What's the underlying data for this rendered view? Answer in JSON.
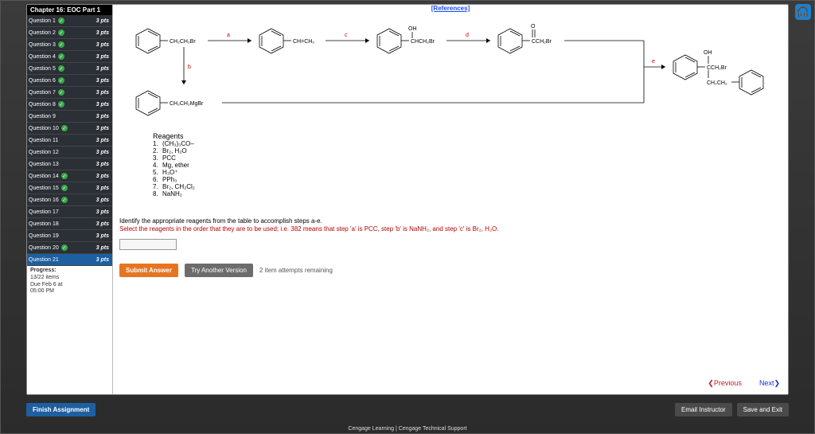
{
  "app": {
    "chapter_title": "Chapter 16: EOC Part 1",
    "references_label": "[References]",
    "footer": "Cengage Learning  |  Cengage Technical Support"
  },
  "sidebar": {
    "questions": [
      {
        "label": "Question 1",
        "checked": true,
        "pts": "3 pts"
      },
      {
        "label": "Question 2",
        "checked": true,
        "pts": "3 pts"
      },
      {
        "label": "Question 3",
        "checked": true,
        "pts": "3 pts"
      },
      {
        "label": "Question 4",
        "checked": true,
        "pts": "3 pts"
      },
      {
        "label": "Question 5",
        "checked": true,
        "pts": "3 pts"
      },
      {
        "label": "Question 6",
        "checked": true,
        "pts": "3 pts"
      },
      {
        "label": "Question 7",
        "checked": true,
        "pts": "3 pts"
      },
      {
        "label": "Question 8",
        "checked": true,
        "pts": "3 pts"
      },
      {
        "label": "Question 9",
        "checked": false,
        "pts": "3 pts"
      },
      {
        "label": "Question 10",
        "checked": true,
        "pts": "3 pts"
      },
      {
        "label": "Question 11",
        "checked": false,
        "pts": "3 pts"
      },
      {
        "label": "Question 12",
        "checked": false,
        "pts": "3 pts"
      },
      {
        "label": "Question 13",
        "checked": false,
        "pts": "3 pts"
      },
      {
        "label": "Question 14",
        "checked": true,
        "pts": "3 pts"
      },
      {
        "label": "Question 15",
        "checked": true,
        "pts": "3 pts"
      },
      {
        "label": "Question 16",
        "checked": true,
        "pts": "3 pts"
      },
      {
        "label": "Question 17",
        "checked": false,
        "pts": "3 pts"
      },
      {
        "label": "Question 18",
        "checked": false,
        "pts": "3 pts"
      },
      {
        "label": "Question 19",
        "checked": false,
        "pts": "3 pts"
      },
      {
        "label": "Question 20",
        "checked": true,
        "pts": "3 pts"
      },
      {
        "label": "Question 21",
        "checked": false,
        "pts": "3 pts"
      }
    ],
    "active_index": 20,
    "progress": {
      "title": "Progress:",
      "count": "13/22 items",
      "due1": "Due Feb 6 at",
      "due2": "05:00 PM"
    }
  },
  "chem": {
    "labels": {
      "a": "a",
      "b": "b",
      "c": "c",
      "d": "d",
      "e": "e",
      "m1": "CH₂CH₂Br",
      "m2": "CH=CH₂",
      "m3top": "OH",
      "m3": "CHCH₂Br",
      "m4top": "O",
      "m4": "CCH₂Br",
      "m5top": "OH",
      "m5a": "CCH₂Br",
      "m5b": "CH₂CH₂",
      "grignard": "CH₂CH₂MgBr"
    }
  },
  "reagents": {
    "title": "Reagents",
    "items": [
      "(CH₃)₃CO–",
      "Br₂, H₂O",
      "PCC",
      "Mg, ether",
      "H₃O⁺",
      "PPh₃",
      "Br₂, CH₂Cl₂",
      "NaNH₂"
    ]
  },
  "instructions": {
    "line1": "Identify the appropriate reagents from the table to accomplish steps a-e.",
    "line2": "Select the reagents in the order that they are to be used; i.e. 382 means that step 'a' is PCC, step 'b' is NaNH₂, and step 'c' is Br₂, H₂O."
  },
  "answer_value": "",
  "buttons": {
    "submit": "Submit Answer",
    "try_another": "Try Another Version",
    "attempts": "2 item attempts remaining",
    "previous": "Previous",
    "next": "Next",
    "finish": "Finish Assignment",
    "email": "Email Instructor",
    "save_exit": "Save and Exit"
  }
}
